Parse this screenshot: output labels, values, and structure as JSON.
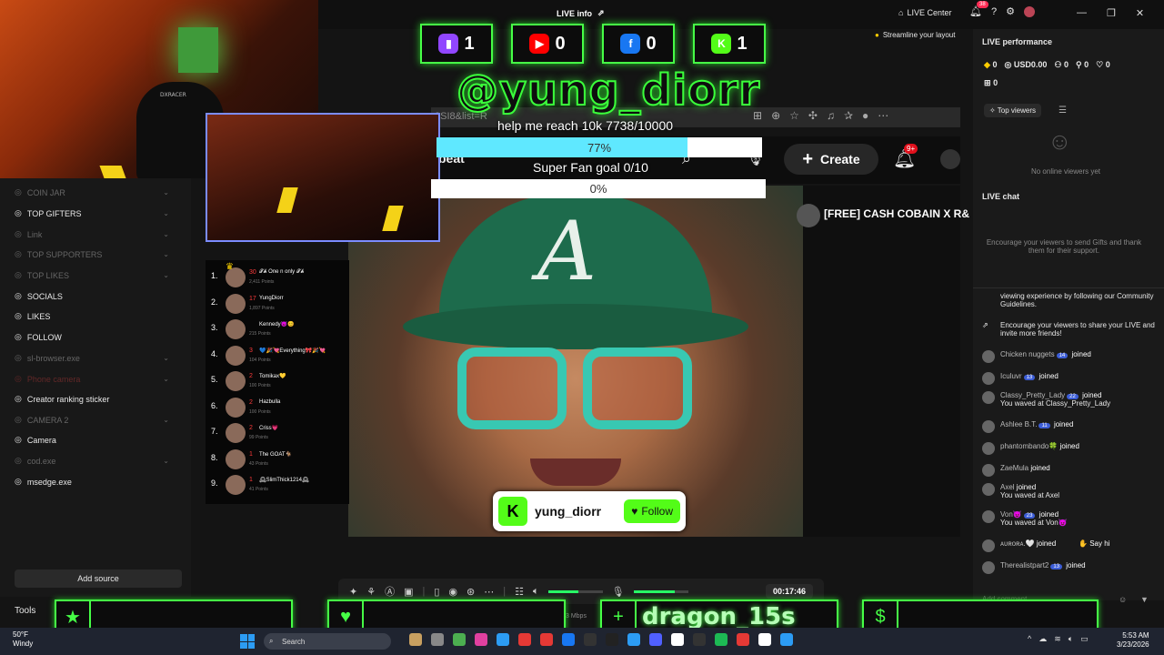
{
  "topbar": {
    "live_info": "LIVE info",
    "live_center": "LIVE Center",
    "notif_count": "38",
    "streamline": "Streamline your layout"
  },
  "overlay": {
    "counters": [
      {
        "platform": "twitch",
        "color": "#9146ff",
        "value": "1"
      },
      {
        "platform": "youtube",
        "color": "#ff0000",
        "value": "0"
      },
      {
        "platform": "facebook",
        "color": "#1877f2",
        "value": "0"
      },
      {
        "platform": "kick",
        "color": "#53fc18",
        "value": "1"
      }
    ],
    "handle": "@yung_diorr",
    "goal1_label": "help me reach 10k  7738/10000",
    "goal1_pct": "77%",
    "goal1_fraction": 0.77,
    "goal2_label": "Super Fan goal  0/10",
    "goal2_pct": "0%",
    "follow_name": "yung_diorr",
    "follow_btn": "Follow",
    "chair_brand": "DXRACER"
  },
  "browser": {
    "url_fragment": "8SI8&list=R",
    "beat": "beat",
    "create": "Create",
    "bell_badge": "9+",
    "side_title": "[FREE] CASH COBAIN X R&"
  },
  "sidebar": {
    "items": [
      {
        "label": "COIN JAR",
        "style": "dim",
        "chev": true
      },
      {
        "label": "TOP GIFTERS",
        "style": "normal",
        "chev": true
      },
      {
        "label": "Link",
        "style": "dim",
        "chev": true
      },
      {
        "label": "TOP SUPPORTERS",
        "style": "dim",
        "chev": true
      },
      {
        "label": "TOP LIKES",
        "style": "dim",
        "chev": true
      },
      {
        "label": "SOCIALS",
        "style": "normal",
        "chev": false
      },
      {
        "label": "LIKES",
        "style": "normal",
        "chev": false
      },
      {
        "label": "FOLLOW",
        "style": "normal",
        "chev": false
      },
      {
        "label": "sl-browser.exe",
        "style": "dim",
        "chev": true
      },
      {
        "label": "Phone camera",
        "style": "red",
        "chev": true
      },
      {
        "label": "Creator ranking sticker",
        "style": "normal",
        "chev": false
      },
      {
        "label": "CAMERA 2",
        "style": "dim",
        "chev": true
      },
      {
        "label": "Camera",
        "style": "normal",
        "chev": false
      },
      {
        "label": "cod.exe",
        "style": "dim",
        "chev": true
      },
      {
        "label": "msedge.exe",
        "style": "normal",
        "chev": false
      }
    ],
    "add_source": "Add source",
    "tools": "Tools"
  },
  "leaderboard": [
    {
      "rank": "1.",
      "level": "30",
      "name": "𝓣𝓱 One n only 𝓣𝓱",
      "points": "2,411 Points"
    },
    {
      "rank": "2.",
      "level": "17",
      "name": "YungDiorr",
      "points": "1,897 Points"
    },
    {
      "rank": "3.",
      "level": "",
      "name": "Kennedy😈😊",
      "points": "215 Points"
    },
    {
      "rank": "4.",
      "level": "3",
      "name": "💙🎉💘Everything🎀🎉💘",
      "points": "104 Points"
    },
    {
      "rank": "5.",
      "level": "2",
      "name": "Tomikax💛",
      "points": "100 Points"
    },
    {
      "rank": "6.",
      "level": "2",
      "name": "Hazbulla",
      "points": "100 Points"
    },
    {
      "rank": "7.",
      "level": "2",
      "name": "Criss💗",
      "points": "99 Points"
    },
    {
      "rank": "8.",
      "level": "1",
      "name": "The GOAT🐐",
      "points": "43 Points"
    },
    {
      "rank": "9.",
      "level": "1",
      "name": "🕰SlimThick1214🕰",
      "points": "41 Points"
    }
  ],
  "right_panel": {
    "title": "LIVE performance",
    "stats": [
      "0",
      "USD0.00",
      "0",
      "0",
      "0"
    ],
    "stat2": "0",
    "top_viewers": "Top viewers",
    "no_viewers": "No online viewers yet",
    "live_chat": "LIVE chat",
    "encourage": "Encourage your viewers to send Gifts and thank them for their support.",
    "guidelines": "viewing experience by following our Community Guidelines.",
    "share": "Encourage your viewers to share your LIVE and invite more friends!",
    "chat": [
      {
        "user": "Chicken nuggets",
        "badge": "14",
        "action": "joined",
        "sub": ""
      },
      {
        "user": "Iculuvr",
        "badge": "13",
        "action": "joined",
        "sub": ""
      },
      {
        "user": "Classy_Pretty_Lady",
        "badge": "22",
        "action": "joined",
        "sub": "You waved at Classy_Pretty_Lady"
      },
      {
        "user": "Ashlee B.T.",
        "badge": "11",
        "action": "joined",
        "sub": ""
      },
      {
        "user": "phantombando🍀",
        "badge": "",
        "action": "joined",
        "sub": ""
      },
      {
        "user": "ZaeMula",
        "badge": "",
        "action": "joined",
        "sub": ""
      },
      {
        "user": "Axel",
        "badge": "",
        "action": "joined",
        "sub": "You waved at Axel"
      },
      {
        "user": "Von😈",
        "badge": "23",
        "action": "joined",
        "sub": "You waved at Von😈"
      },
      {
        "user": "ᴀᴜʀᴏʀᴀ.🤍",
        "badge": "",
        "action": "joined",
        "sub": ""
      },
      {
        "user": "Therealistpart2",
        "badge": "13",
        "action": "joined",
        "sub": ""
      }
    ],
    "say_hi": "Say hi",
    "add_comment": "Add comment..."
  },
  "controls": {
    "timer": "00:17:46",
    "mbps": "3 Mbps",
    "slider1": 0.55,
    "slider2": 0.75
  },
  "bottom_boxes": [
    {
      "icon": "star-icon",
      "glyph": "★",
      "text": ""
    },
    {
      "icon": "heart-icon",
      "glyph": "♥",
      "text": ""
    },
    {
      "icon": "add-user-icon",
      "glyph": "+",
      "text": "dragon_15s"
    },
    {
      "icon": "dollar-icon",
      "glyph": "$",
      "text": ""
    }
  ],
  "taskbar": {
    "temp": "50°F",
    "condition": "Windy",
    "search": "Search",
    "time": "5:53 AM",
    "date": "3/23/2026"
  }
}
